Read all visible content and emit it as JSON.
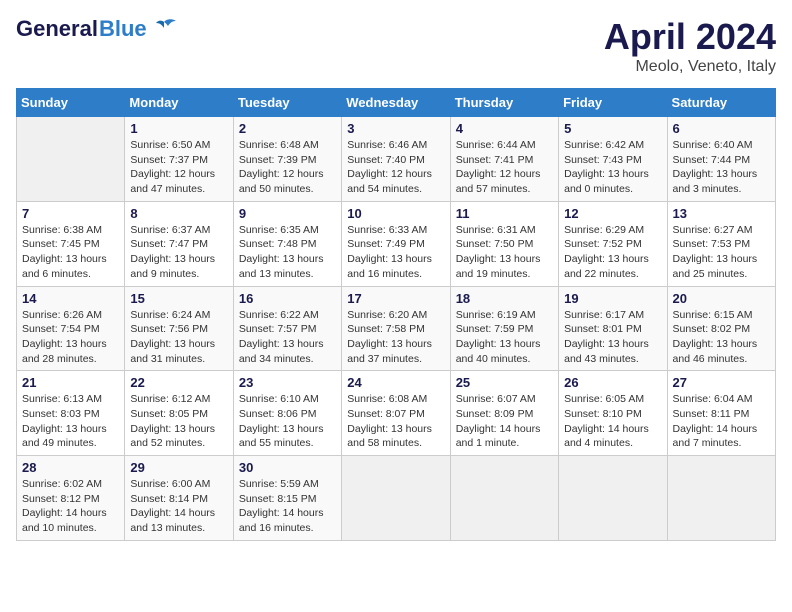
{
  "logo": {
    "general": "General",
    "blue": "Blue"
  },
  "title": "April 2024",
  "subtitle": "Meolo, Veneto, Italy",
  "weekdays": [
    "Sunday",
    "Monday",
    "Tuesday",
    "Wednesday",
    "Thursday",
    "Friday",
    "Saturday"
  ],
  "weeks": [
    [
      {
        "day": "",
        "info": ""
      },
      {
        "day": "1",
        "info": "Sunrise: 6:50 AM\nSunset: 7:37 PM\nDaylight: 12 hours\nand 47 minutes."
      },
      {
        "day": "2",
        "info": "Sunrise: 6:48 AM\nSunset: 7:39 PM\nDaylight: 12 hours\nand 50 minutes."
      },
      {
        "day": "3",
        "info": "Sunrise: 6:46 AM\nSunset: 7:40 PM\nDaylight: 12 hours\nand 54 minutes."
      },
      {
        "day": "4",
        "info": "Sunrise: 6:44 AM\nSunset: 7:41 PM\nDaylight: 12 hours\nand 57 minutes."
      },
      {
        "day": "5",
        "info": "Sunrise: 6:42 AM\nSunset: 7:43 PM\nDaylight: 13 hours\nand 0 minutes."
      },
      {
        "day": "6",
        "info": "Sunrise: 6:40 AM\nSunset: 7:44 PM\nDaylight: 13 hours\nand 3 minutes."
      }
    ],
    [
      {
        "day": "7",
        "info": "Sunrise: 6:38 AM\nSunset: 7:45 PM\nDaylight: 13 hours\nand 6 minutes."
      },
      {
        "day": "8",
        "info": "Sunrise: 6:37 AM\nSunset: 7:47 PM\nDaylight: 13 hours\nand 9 minutes."
      },
      {
        "day": "9",
        "info": "Sunrise: 6:35 AM\nSunset: 7:48 PM\nDaylight: 13 hours\nand 13 minutes."
      },
      {
        "day": "10",
        "info": "Sunrise: 6:33 AM\nSunset: 7:49 PM\nDaylight: 13 hours\nand 16 minutes."
      },
      {
        "day": "11",
        "info": "Sunrise: 6:31 AM\nSunset: 7:50 PM\nDaylight: 13 hours\nand 19 minutes."
      },
      {
        "day": "12",
        "info": "Sunrise: 6:29 AM\nSunset: 7:52 PM\nDaylight: 13 hours\nand 22 minutes."
      },
      {
        "day": "13",
        "info": "Sunrise: 6:27 AM\nSunset: 7:53 PM\nDaylight: 13 hours\nand 25 minutes."
      }
    ],
    [
      {
        "day": "14",
        "info": "Sunrise: 6:26 AM\nSunset: 7:54 PM\nDaylight: 13 hours\nand 28 minutes."
      },
      {
        "day": "15",
        "info": "Sunrise: 6:24 AM\nSunset: 7:56 PM\nDaylight: 13 hours\nand 31 minutes."
      },
      {
        "day": "16",
        "info": "Sunrise: 6:22 AM\nSunset: 7:57 PM\nDaylight: 13 hours\nand 34 minutes."
      },
      {
        "day": "17",
        "info": "Sunrise: 6:20 AM\nSunset: 7:58 PM\nDaylight: 13 hours\nand 37 minutes."
      },
      {
        "day": "18",
        "info": "Sunrise: 6:19 AM\nSunset: 7:59 PM\nDaylight: 13 hours\nand 40 minutes."
      },
      {
        "day": "19",
        "info": "Sunrise: 6:17 AM\nSunset: 8:01 PM\nDaylight: 13 hours\nand 43 minutes."
      },
      {
        "day": "20",
        "info": "Sunrise: 6:15 AM\nSunset: 8:02 PM\nDaylight: 13 hours\nand 46 minutes."
      }
    ],
    [
      {
        "day": "21",
        "info": "Sunrise: 6:13 AM\nSunset: 8:03 PM\nDaylight: 13 hours\nand 49 minutes."
      },
      {
        "day": "22",
        "info": "Sunrise: 6:12 AM\nSunset: 8:05 PM\nDaylight: 13 hours\nand 52 minutes."
      },
      {
        "day": "23",
        "info": "Sunrise: 6:10 AM\nSunset: 8:06 PM\nDaylight: 13 hours\nand 55 minutes."
      },
      {
        "day": "24",
        "info": "Sunrise: 6:08 AM\nSunset: 8:07 PM\nDaylight: 13 hours\nand 58 minutes."
      },
      {
        "day": "25",
        "info": "Sunrise: 6:07 AM\nSunset: 8:09 PM\nDaylight: 14 hours\nand 1 minute."
      },
      {
        "day": "26",
        "info": "Sunrise: 6:05 AM\nSunset: 8:10 PM\nDaylight: 14 hours\nand 4 minutes."
      },
      {
        "day": "27",
        "info": "Sunrise: 6:04 AM\nSunset: 8:11 PM\nDaylight: 14 hours\nand 7 minutes."
      }
    ],
    [
      {
        "day": "28",
        "info": "Sunrise: 6:02 AM\nSunset: 8:12 PM\nDaylight: 14 hours\nand 10 minutes."
      },
      {
        "day": "29",
        "info": "Sunrise: 6:00 AM\nSunset: 8:14 PM\nDaylight: 14 hours\nand 13 minutes."
      },
      {
        "day": "30",
        "info": "Sunrise: 5:59 AM\nSunset: 8:15 PM\nDaylight: 14 hours\nand 16 minutes."
      },
      {
        "day": "",
        "info": ""
      },
      {
        "day": "",
        "info": ""
      },
      {
        "day": "",
        "info": ""
      },
      {
        "day": "",
        "info": ""
      }
    ]
  ]
}
